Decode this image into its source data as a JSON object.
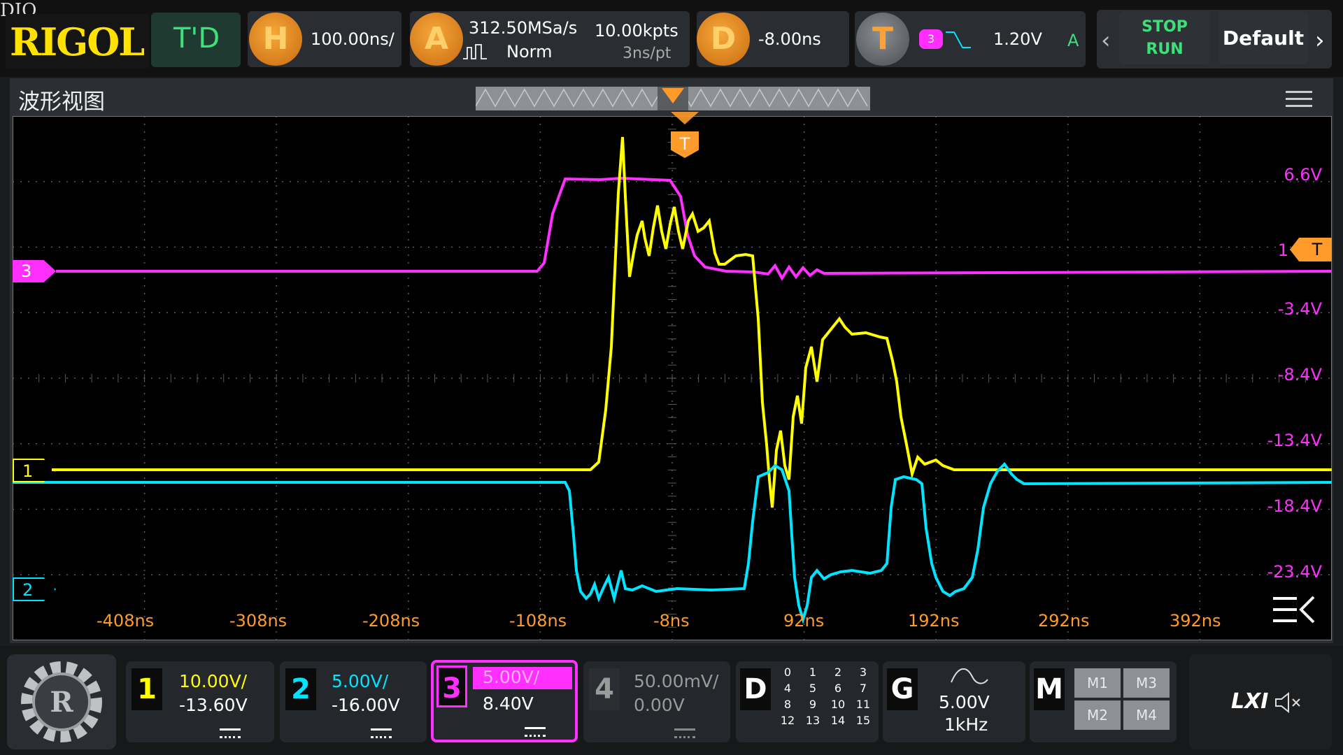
{
  "corner_text": "DIO",
  "brand": "RIGOL",
  "mode": "T'D",
  "horizontal": {
    "letter": "H",
    "scale": "100.00ns/"
  },
  "acquire": {
    "letter": "A",
    "rate": "312.50MSa/s",
    "depth": "10.00kpts",
    "mode": "Norm",
    "per_point": "3ns/pt"
  },
  "delay": {
    "letter": "D",
    "value": "-8.00ns"
  },
  "trigger": {
    "letter": "T",
    "source": "3",
    "level": "1.20V",
    "sweep": "A"
  },
  "run_control": {
    "stop": "STOP",
    "run": "RUN"
  },
  "default_label": "Default",
  "panel_title": "波形视图",
  "trigger_marker": "T",
  "trigger_level_marker": {
    "level_label": "1",
    "letter": "T"
  },
  "volt_labels": [
    "6.6V",
    "1",
    "-3.4V",
    "-8.4V",
    "-13.4V",
    "-18.4V",
    "-23.4V"
  ],
  "time_labels": [
    "-408ns",
    "-308ns",
    "-208ns",
    "-108ns",
    "-8ns",
    "92ns",
    "192ns",
    "292ns",
    "392ns"
  ],
  "channel_markers": [
    "1",
    "2",
    "3"
  ],
  "channels": [
    {
      "num": "1",
      "scale": "10.00V/",
      "offset": "-13.60V",
      "color": "#ffff00"
    },
    {
      "num": "2",
      "scale": "5.00V/",
      "offset": "-16.00V",
      "color": "#00e5ff"
    },
    {
      "num": "3",
      "scale": "5.00V/",
      "offset": "8.40V",
      "color": "#ff2fff"
    },
    {
      "num": "4",
      "scale": "50.00mV/",
      "offset": "0.00V",
      "color": "#9a9a9a"
    }
  ],
  "digital": {
    "letter": "D",
    "bits": [
      "0",
      "1",
      "2",
      "3",
      "4",
      "5",
      "6",
      "7",
      "8",
      "9",
      "10",
      "11",
      "12",
      "13",
      "14",
      "15"
    ]
  },
  "generator": {
    "letter": "G",
    "amplitude": "5.00V",
    "frequency": "1kHz"
  },
  "math": {
    "letter": "M",
    "items": [
      "M1",
      "M3",
      "M2",
      "M4"
    ]
  },
  "lxi": "LXI",
  "colors": {
    "ch1": "#ffff00",
    "ch2": "#00e5ff",
    "ch3": "#ff2fff",
    "trigger": "#ff9b2a",
    "grid": "#5a5a5a"
  }
}
